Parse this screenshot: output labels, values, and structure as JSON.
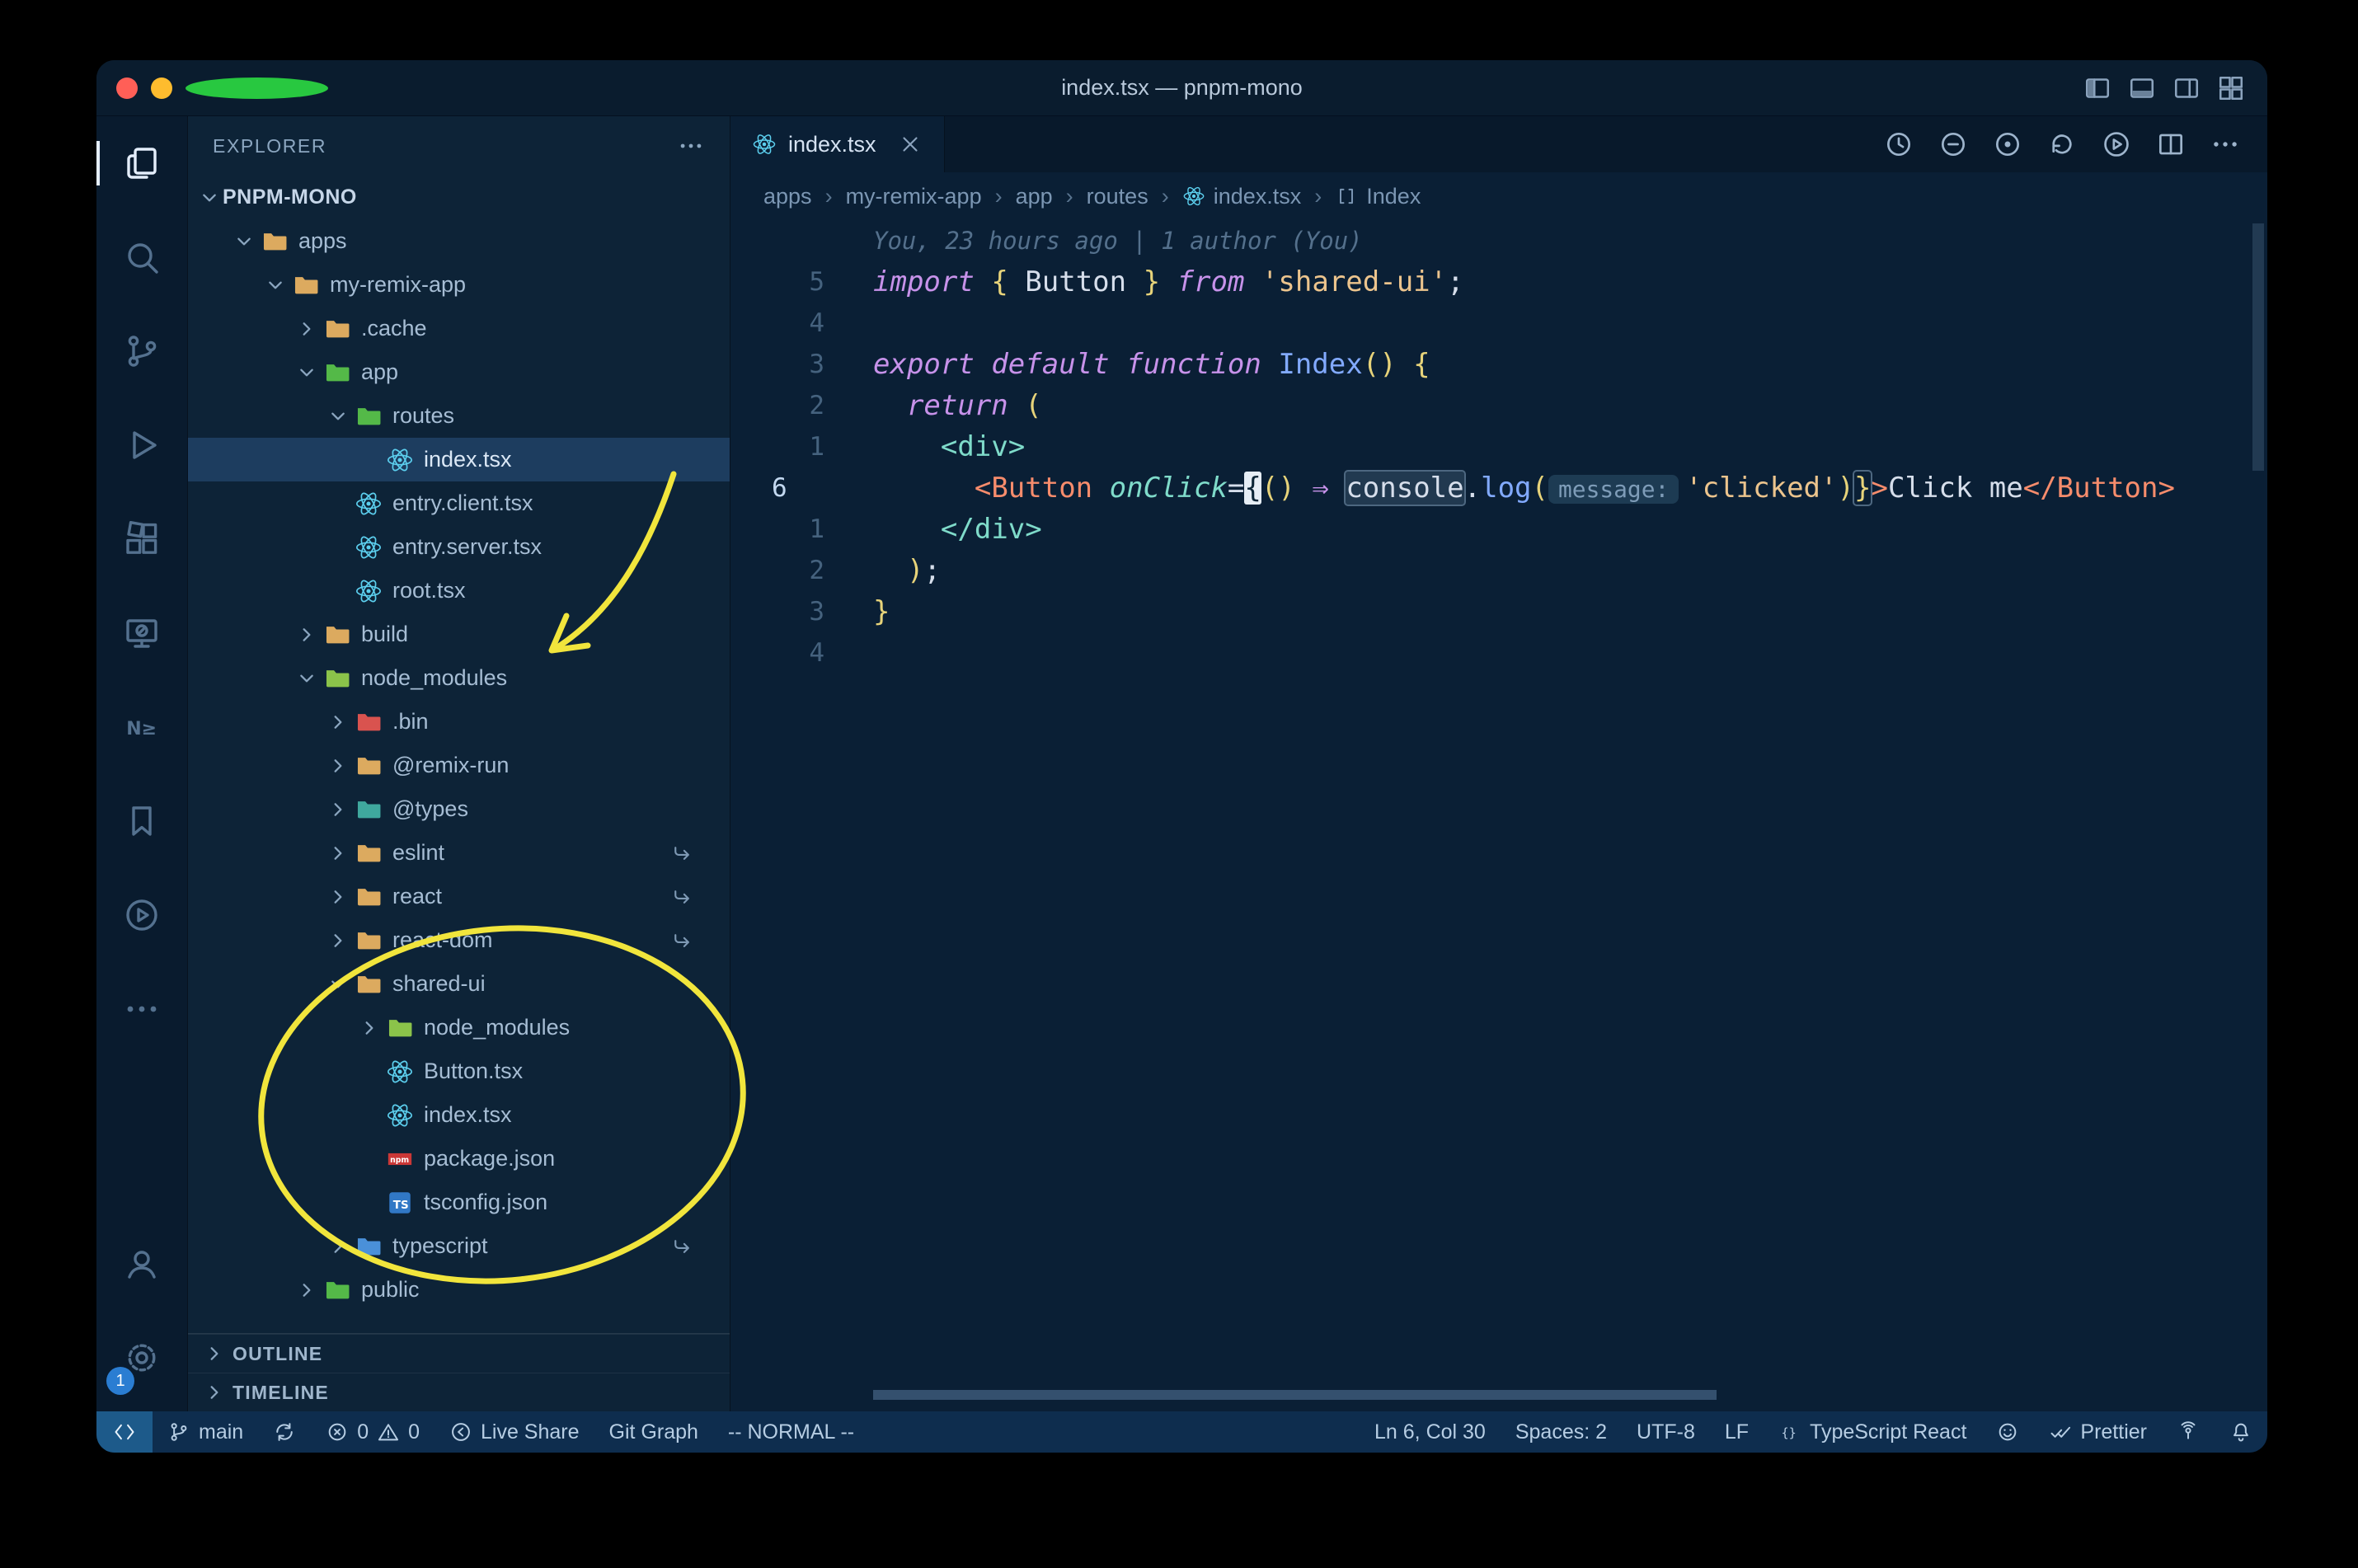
{
  "window": {
    "title": "index.tsx — pnpm-mono",
    "layout_icons": [
      "toggle-primary-sidebar",
      "toggle-panel",
      "toggle-secondary-sidebar",
      "customize-layout"
    ]
  },
  "activity_bar": {
    "items": [
      {
        "name": "explorer",
        "active": true
      },
      {
        "name": "search",
        "active": false
      },
      {
        "name": "source-control",
        "active": false
      },
      {
        "name": "run-and-debug",
        "active": false
      },
      {
        "name": "extensions",
        "active": false
      },
      {
        "name": "remote-explorer",
        "active": false
      },
      {
        "name": "nx-console",
        "active": false
      },
      {
        "name": "bookmarks",
        "active": false
      },
      {
        "name": "code-runner",
        "active": false
      },
      {
        "name": "more",
        "active": false
      }
    ],
    "bottom": [
      {
        "name": "accounts"
      },
      {
        "name": "settings",
        "badge": "1"
      }
    ]
  },
  "sidebar": {
    "header": "EXPLORER",
    "root": {
      "label": "PNPM-MONO"
    },
    "tree": [
      {
        "label": "apps",
        "depth": 1,
        "chevron": "open",
        "icon": "folder",
        "color": "#dcaa5f"
      },
      {
        "label": "my-remix-app",
        "depth": 2,
        "chevron": "open",
        "icon": "folder",
        "color": "#dcaa5f"
      },
      {
        "label": ".cache",
        "depth": 3,
        "chevron": "closed",
        "icon": "folder",
        "color": "#dcaa5f"
      },
      {
        "label": "app",
        "depth": 3,
        "chevron": "open",
        "icon": "folder",
        "color": "#54b948"
      },
      {
        "label": "routes",
        "depth": 4,
        "chevron": "open",
        "icon": "folder",
        "color": "#54b948"
      },
      {
        "label": "index.tsx",
        "depth": 5,
        "icon": "react",
        "selected": true
      },
      {
        "label": "entry.client.tsx",
        "depth": 4,
        "icon": "react"
      },
      {
        "label": "entry.server.tsx",
        "depth": 4,
        "icon": "react"
      },
      {
        "label": "root.tsx",
        "depth": 4,
        "icon": "react"
      },
      {
        "label": "build",
        "depth": 3,
        "chevron": "closed",
        "icon": "folder",
        "color": "#dcaa5f"
      },
      {
        "label": "node_modules",
        "depth": 3,
        "chevron": "open",
        "icon": "folder",
        "color": "#8bc34a"
      },
      {
        "label": ".bin",
        "depth": 4,
        "chevron": "closed",
        "icon": "folder",
        "color": "#d9534f"
      },
      {
        "label": "@remix-run",
        "depth": 4,
        "chevron": "closed",
        "icon": "folder",
        "color": "#dcaa5f"
      },
      {
        "label": "@types",
        "depth": 4,
        "chevron": "closed",
        "icon": "folder",
        "color": "#3fa89e"
      },
      {
        "label": "eslint",
        "depth": 4,
        "chevron": "closed",
        "icon": "folder",
        "color": "#dcaa5f",
        "symlink": true
      },
      {
        "label": "react",
        "depth": 4,
        "chevron": "closed",
        "icon": "folder",
        "color": "#dcaa5f",
        "symlink": true
      },
      {
        "label": "react-dom",
        "depth": 4,
        "chevron": "closed",
        "icon": "folder",
        "color": "#dcaa5f",
        "symlink": true
      },
      {
        "label": "shared-ui",
        "depth": 4,
        "chevron": "open",
        "icon": "folder",
        "color": "#dcaa5f"
      },
      {
        "label": "node_modules",
        "depth": 5,
        "chevron": "closed",
        "icon": "folder",
        "color": "#8bc34a"
      },
      {
        "label": "Button.tsx",
        "depth": 5,
        "icon": "react"
      },
      {
        "label": "index.tsx",
        "depth": 5,
        "icon": "react"
      },
      {
        "label": "package.json",
        "depth": 5,
        "icon": "npm"
      },
      {
        "label": "tsconfig.json",
        "depth": 5,
        "icon": "ts"
      },
      {
        "label": "typescript",
        "depth": 4,
        "chevron": "closed",
        "icon": "folder",
        "color": "#4a90d9",
        "symlink": true
      },
      {
        "label": "public",
        "depth": 3,
        "chevron": "closed",
        "icon": "folder",
        "color": "#54b948"
      }
    ],
    "sections": [
      {
        "label": "OUTLINE"
      },
      {
        "label": "TIMELINE"
      }
    ]
  },
  "editor": {
    "tab": {
      "label": "index.tsx",
      "icon": "react"
    },
    "actions": [
      "timeline",
      "open-changes",
      "goto-symbol",
      "sync-file",
      "run-file",
      "split-editor",
      "more-actions"
    ],
    "breadcrumbs": [
      {
        "label": "apps"
      },
      {
        "label": "my-remix-app"
      },
      {
        "label": "app"
      },
      {
        "label": "routes"
      },
      {
        "label": "index.tsx",
        "icon": "react"
      },
      {
        "label": "Index",
        "icon": "symbol"
      }
    ],
    "blame": "You, 23 hours ago | 1 author (You)",
    "lines": [
      {
        "gutter": "5",
        "tokens": [
          [
            "import",
            "kw"
          ],
          [
            " ",
            "t"
          ],
          [
            "{",
            "b"
          ],
          [
            " ",
            "t"
          ],
          [
            "Button",
            "t"
          ],
          [
            " ",
            "t"
          ],
          [
            "}",
            "b"
          ],
          [
            " ",
            "t"
          ],
          [
            "from",
            "kw"
          ],
          [
            " ",
            "t"
          ],
          [
            "'shared-ui'",
            "str"
          ],
          [
            ";",
            "t"
          ]
        ]
      },
      {
        "gutter": "4",
        "tokens": []
      },
      {
        "gutter": "3",
        "tokens": [
          [
            "export",
            "kw"
          ],
          [
            " ",
            "t"
          ],
          [
            "default",
            "kw"
          ],
          [
            " ",
            "t"
          ],
          [
            "function",
            "kw"
          ],
          [
            " ",
            "t"
          ],
          [
            "Index",
            "fn"
          ],
          [
            "(",
            "b"
          ],
          [
            ")",
            "b"
          ],
          [
            " ",
            "t"
          ],
          [
            "{",
            "b"
          ]
        ]
      },
      {
        "gutter": "2",
        "tokens": [
          [
            "  ",
            "t"
          ],
          [
            "return",
            "kw"
          ],
          [
            " ",
            "t"
          ],
          [
            "(",
            "b"
          ]
        ]
      },
      {
        "gutter": "1",
        "tokens": [
          [
            "    ",
            "t"
          ],
          [
            "<",
            "tag"
          ],
          [
            "div",
            "tag"
          ],
          [
            ">",
            "tag"
          ]
        ]
      },
      {
        "gutter": "6",
        "current": true,
        "tokens": [
          [
            "      ",
            "t"
          ],
          [
            "<",
            "comp"
          ],
          [
            "Button",
            "comp"
          ],
          [
            " ",
            "t"
          ],
          [
            "onClick",
            "attr"
          ],
          [
            "=",
            "t"
          ],
          [
            "{",
            "blk"
          ],
          [
            "(",
            "b"
          ],
          [
            ")",
            "b"
          ],
          [
            " ",
            "t"
          ],
          [
            "⇒",
            "arrow"
          ],
          [
            " ",
            "t"
          ],
          [
            "console",
            "hl"
          ],
          [
            ".",
            "t"
          ],
          [
            "log",
            "fn"
          ],
          [
            "(",
            "b"
          ],
          [
            "message:",
            "inlay"
          ],
          [
            "'clicked'",
            "str"
          ],
          [
            ")",
            "b"
          ],
          [
            "}",
            "bm"
          ],
          [
            ">",
            "comp"
          ],
          [
            "Click me",
            "t"
          ],
          [
            "</",
            "comp"
          ],
          [
            "Button",
            "comp"
          ],
          [
            ">",
            "comp"
          ]
        ]
      },
      {
        "gutter": "1",
        "tokens": [
          [
            "    ",
            "t"
          ],
          [
            "</",
            "tag"
          ],
          [
            "div",
            "tag"
          ],
          [
            ">",
            "tag"
          ]
        ]
      },
      {
        "gutter": "2",
        "tokens": [
          [
            "  ",
            "t"
          ],
          [
            ")",
            "b"
          ],
          [
            ";",
            "t"
          ]
        ]
      },
      {
        "gutter": "3",
        "tokens": [
          [
            "}",
            "b"
          ]
        ]
      },
      {
        "gutter": "4",
        "tokens": []
      }
    ]
  },
  "status_bar": {
    "left": [
      {
        "name": "remote",
        "parts": [
          {
            "icon": "remote"
          }
        ]
      },
      {
        "name": "branch",
        "parts": [
          {
            "icon": "branch"
          },
          {
            "text": "main"
          }
        ]
      },
      {
        "name": "sync",
        "parts": [
          {
            "icon": "sync"
          }
        ]
      },
      {
        "name": "problems",
        "parts": [
          {
            "icon": "error"
          },
          {
            "text": "0"
          },
          {
            "icon": "warning"
          },
          {
            "text": "0"
          }
        ]
      },
      {
        "name": "live-share",
        "parts": [
          {
            "icon": "liveshare"
          },
          {
            "text": "Live Share"
          }
        ]
      },
      {
        "name": "git-graph",
        "parts": [
          {
            "text": "Git Graph"
          }
        ]
      },
      {
        "name": "vim-mode",
        "parts": [
          {
            "text": "-- NORMAL --"
          }
        ]
      }
    ],
    "right": [
      {
        "name": "cursor-position",
        "parts": [
          {
            "text": "Ln 6, Col 30"
          }
        ]
      },
      {
        "name": "indentation",
        "parts": [
          {
            "text": "Spaces: 2"
          }
        ]
      },
      {
        "name": "encoding",
        "parts": [
          {
            "text": "UTF-8"
          }
        ]
      },
      {
        "name": "eol",
        "parts": [
          {
            "text": "LF"
          }
        ]
      },
      {
        "name": "language-mode",
        "parts": [
          {
            "icon": "braces"
          },
          {
            "text": "TypeScript React"
          }
        ]
      },
      {
        "name": "feedback",
        "parts": [
          {
            "icon": "smiley"
          }
        ]
      },
      {
        "name": "prettier",
        "parts": [
          {
            "icon": "check"
          },
          {
            "text": "Prettier"
          }
        ]
      },
      {
        "name": "broadcast",
        "parts": [
          {
            "icon": "broadcast"
          }
        ]
      },
      {
        "name": "notifications",
        "parts": [
          {
            "icon": "bell"
          }
        ]
      }
    ]
  },
  "annotations": {
    "color": "#f1e53c"
  }
}
